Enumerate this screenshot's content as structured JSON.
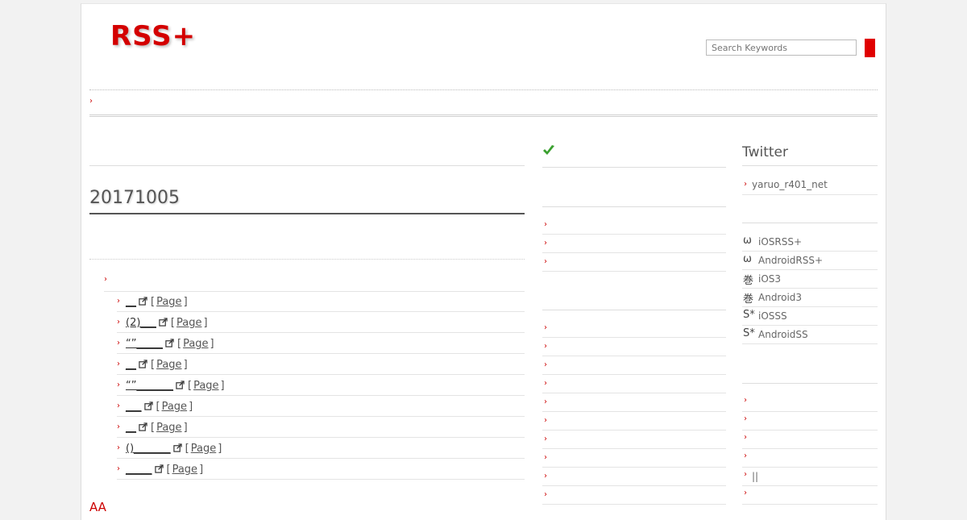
{
  "header": {
    "logo": "RSS+",
    "search_placeholder": "Search Keywords"
  },
  "main": {
    "date_heading": "20171005",
    "links": [
      {
        "title": "__",
        "page_label": "Page"
      },
      {
        "title": "(2)___",
        "page_label": "Page"
      },
      {
        "title": "“”_____",
        "page_label": "Page"
      },
      {
        "title": "__",
        "page_label": "Page"
      },
      {
        "title": "“”_______",
        "page_label": "Page"
      },
      {
        "title": "___",
        "page_label": "Page"
      },
      {
        "title": "__",
        "page_label": "Page"
      },
      {
        "title": "()_______",
        "page_label": "Page"
      },
      {
        "title": "_____",
        "page_label": "Page"
      }
    ],
    "footer_text": "AA"
  },
  "sidebar_right": {
    "twitter_title": "Twitter",
    "twitter_account": "yaruo_r401_net",
    "apps": [
      {
        "icon": "ω",
        "label": "iOSRSS+"
      },
      {
        "icon": "ω",
        "label": "AndroidRSS+"
      },
      {
        "icon": "巻",
        "label": "iOS3"
      },
      {
        "icon": "巻",
        "label": "Android3"
      },
      {
        "icon": "S*",
        "label": "iOSSS"
      },
      {
        "icon": "S*",
        "label": "AndroidSS"
      }
    ],
    "misc": [
      "",
      "",
      "",
      "",
      "||",
      ""
    ]
  },
  "colors": {
    "brand": "#d40000",
    "check": "#3aa02f"
  }
}
